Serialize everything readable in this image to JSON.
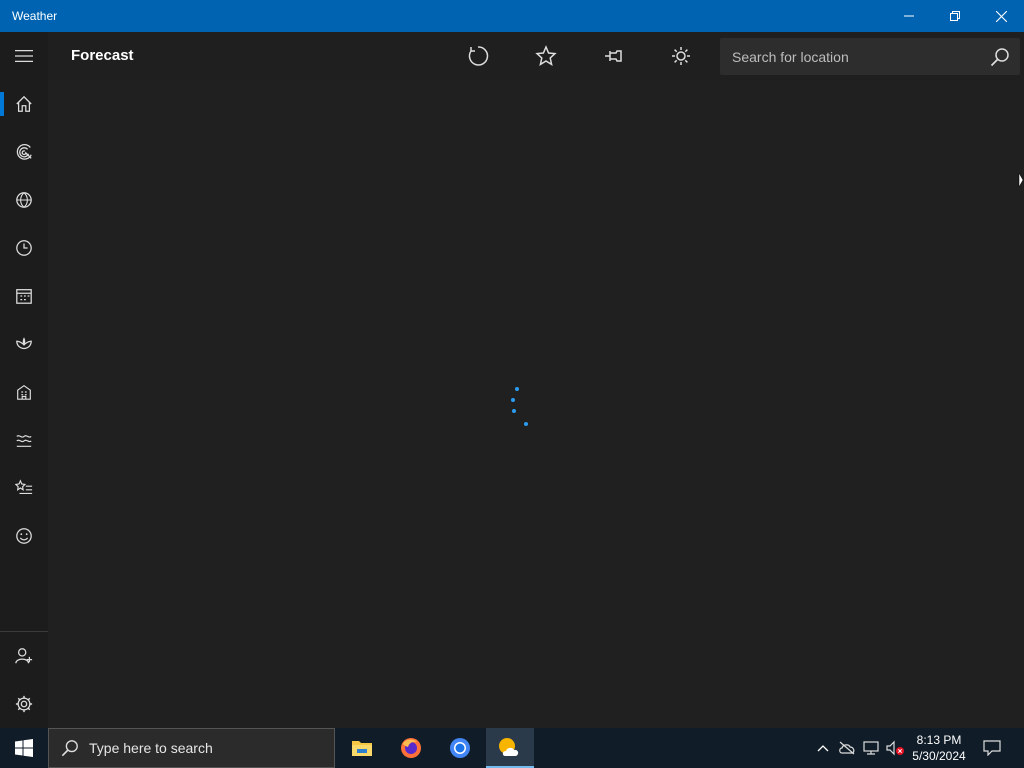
{
  "window": {
    "title": "Weather"
  },
  "header": {
    "title": "Forecast",
    "buttons": [
      "refresh-icon",
      "favorite-star-icon",
      "pin-icon",
      "brightness-icon"
    ]
  },
  "search": {
    "placeholder": "Search for location"
  },
  "sidebar": {
    "items": [
      {
        "icon": "menu-icon"
      },
      {
        "icon": "home-icon",
        "active": true
      },
      {
        "icon": "radar-icon"
      },
      {
        "icon": "globe-icon"
      },
      {
        "icon": "clock-icon"
      },
      {
        "icon": "calendar-icon"
      },
      {
        "icon": "lotus-icon"
      },
      {
        "icon": "building-icon"
      },
      {
        "icon": "waves-icon"
      },
      {
        "icon": "favorites-list-icon"
      },
      {
        "icon": "smiley-icon"
      },
      {
        "icon": "account-icon"
      },
      {
        "icon": "settings-icon"
      }
    ]
  },
  "taskbar": {
    "search_placeholder": "Type here to search",
    "apps": [
      "file-explorer-icon",
      "firefox-icon",
      "chrome-icon",
      "weather-app-icon"
    ],
    "time": "8:13 PM",
    "date": "5/30/2024"
  },
  "colors": {
    "titlebar": "#0063b1",
    "accent": "#0078d7",
    "spinner": "#2b9bef",
    "background": "#202020"
  }
}
